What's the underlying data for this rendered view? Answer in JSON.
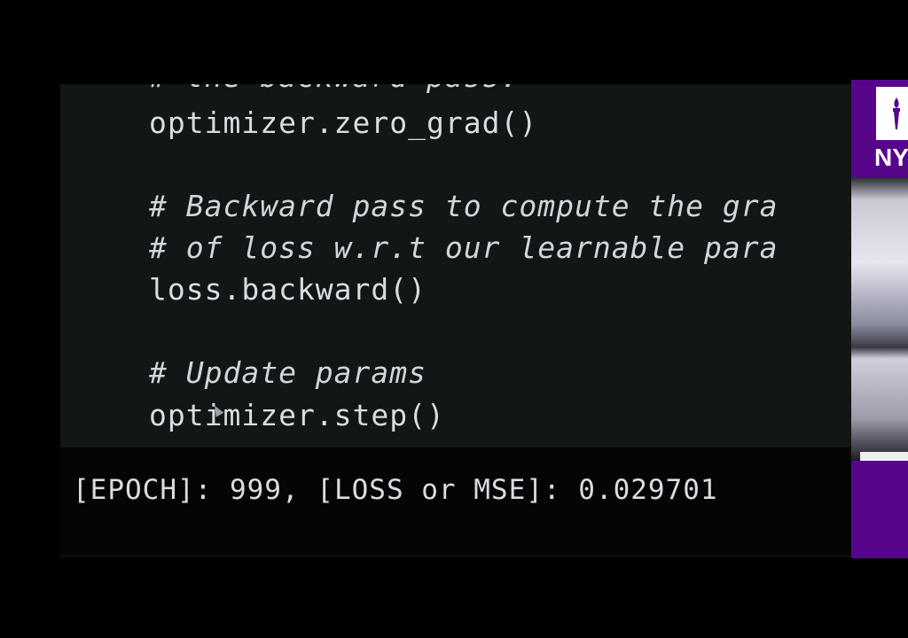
{
  "code_lines": [
    "# the backward pass.",
    "optimizer.zero_grad()",
    "# Backward pass to compute the gra",
    "# of loss w.r.t our learnable para",
    "loss.backward()",
    "# Update params",
    "optimizer.step()"
  ],
  "output_line": "[EPOCH]: 999, [LOSS or MSE]: 0.029701",
  "side_panel": {
    "logo_text": "NY",
    "logo_icon": "torch-icon"
  },
  "colors": {
    "background": "#000000",
    "code_cell": "#121615",
    "text": "#d8dde2",
    "nyu_purple": "#57068c"
  }
}
